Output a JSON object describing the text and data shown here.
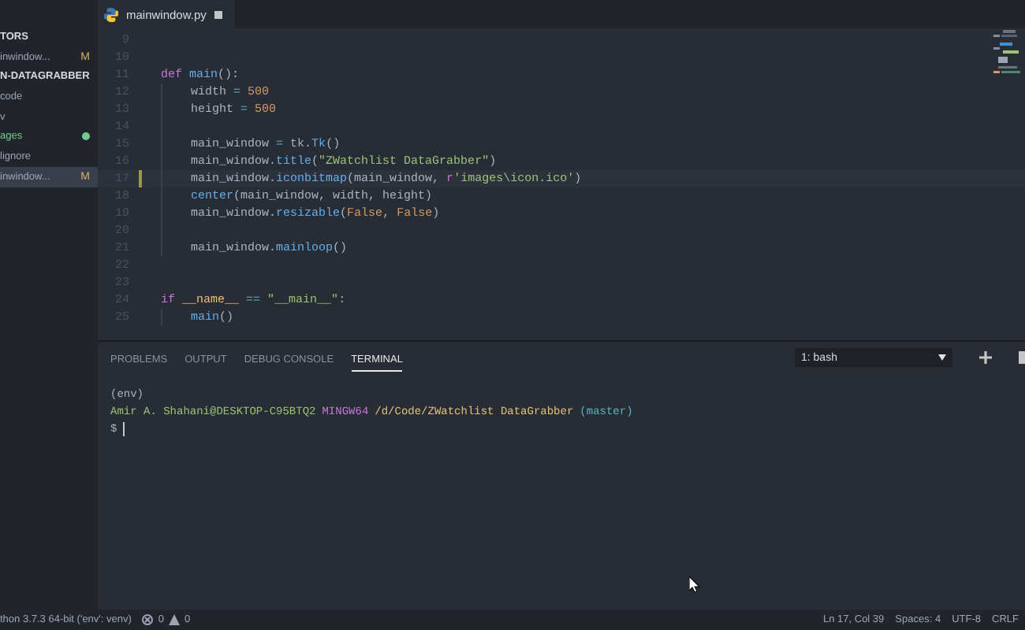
{
  "tab": {
    "title": "mainwindow.py",
    "modified": true
  },
  "sidebar": {
    "items": [
      {
        "label": "TORS",
        "kind": "header",
        "selected": false
      },
      {
        "label": "inwindow...",
        "badge": "M",
        "kind": "file",
        "selected": false
      },
      {
        "label": "N-DATAGRABBER",
        "kind": "header",
        "selected": false
      },
      {
        "label": "code",
        "kind": "folder",
        "selected": false
      },
      {
        "label": "v",
        "kind": "folder",
        "selected": false
      },
      {
        "label": "ages",
        "kind": "untracked",
        "selected": false
      },
      {
        "label": "lignore",
        "kind": "file",
        "selected": false
      },
      {
        "label": "inwindow...",
        "badge": "M",
        "kind": "file",
        "selected": true
      }
    ]
  },
  "editor": {
    "lines": [
      {
        "number": "9",
        "current": false
      },
      {
        "number": "10",
        "current": false
      },
      {
        "number": "11",
        "tokens": [
          {
            "text": "def ",
            "kind": "keyword"
          },
          {
            "text": "main",
            "kind": "func"
          },
          {
            "text": "():",
            "kind": "plain"
          }
        ],
        "current": false,
        "children": [
          {
            "number": "12",
            "tokens": [
              {
                "text": "width ",
                "kind": "plain"
              },
              {
                "text": "= ",
                "kind": "op"
              },
              {
                "text": "500",
                "kind": "number"
              }
            ],
            "current": false
          },
          {
            "number": "13",
            "tokens": [
              {
                "text": "height ",
                "kind": "plain"
              },
              {
                "text": "= ",
                "kind": "op"
              },
              {
                "text": "500",
                "kind": "number"
              }
            ],
            "current": false
          },
          {
            "number": "14",
            "current": false
          },
          {
            "number": "15",
            "tokens": [
              {
                "text": "main_window ",
                "kind": "plain"
              },
              {
                "text": "= ",
                "kind": "op"
              },
              {
                "text": "tk.",
                "kind": "plain"
              },
              {
                "text": "Tk",
                "kind": "func"
              },
              {
                "text": "()",
                "kind": "plain"
              }
            ],
            "current": false
          },
          {
            "number": "16",
            "tokens": [
              {
                "text": "main_window.",
                "kind": "plain"
              },
              {
                "text": "title",
                "kind": "func"
              },
              {
                "text": "(",
                "kind": "plain"
              },
              {
                "text": "\"ZWatchlist DataGrabber\"",
                "kind": "string"
              },
              {
                "text": ")",
                "kind": "plain"
              }
            ],
            "current": false
          },
          {
            "number": "17",
            "tokens": [
              {
                "text": "main_window.",
                "kind": "plain"
              },
              {
                "text": "iconbitmap",
                "kind": "func"
              },
              {
                "text": "(main_window, ",
                "kind": "plain"
              },
              {
                "text": "r",
                "kind": "keyword"
              },
              {
                "text": "'images\\icon.ico'",
                "kind": "string"
              },
              {
                "text": ")",
                "kind": "plain"
              }
            ],
            "current": true
          },
          {
            "number": "18",
            "tokens": [
              {
                "text": "center",
                "kind": "func"
              },
              {
                "text": "(main_window, width, height)",
                "kind": "plain"
              }
            ],
            "current": false
          },
          {
            "number": "19",
            "tokens": [
              {
                "text": "main_window.",
                "kind": "plain"
              },
              {
                "text": "resizable",
                "kind": "func"
              },
              {
                "text": "(",
                "kind": "plain"
              },
              {
                "text": "False",
                "kind": "number"
              },
              {
                "text": ", ",
                "kind": "plain"
              },
              {
                "text": "False",
                "kind": "number"
              },
              {
                "text": ")",
                "kind": "plain"
              }
            ],
            "current": false
          },
          {
            "number": "20",
            "current": false
          },
          {
            "number": "21",
            "tokens": [
              {
                "text": "main_window.",
                "kind": "plain"
              },
              {
                "text": "mainloop",
                "kind": "func"
              },
              {
                "text": "()",
                "kind": "plain"
              }
            ],
            "current": false
          }
        ]
      },
      {
        "number": "22",
        "current": false
      },
      {
        "number": "23",
        "current": false
      },
      {
        "number": "24",
        "tokens": [
          {
            "text": "if ",
            "kind": "keyword"
          },
          {
            "text": "__name__ ",
            "kind": "param"
          },
          {
            "text": "== ",
            "kind": "op"
          },
          {
            "text": "\"__main__\"",
            "kind": "string"
          },
          {
            "text": ":",
            "kind": "plain"
          }
        ],
        "current": false,
        "children": [
          {
            "number": "25",
            "tokens": [
              {
                "text": "main",
                "kind": "func"
              },
              {
                "text": "()",
                "kind": "plain"
              }
            ],
            "current": false
          }
        ]
      }
    ]
  },
  "panel": {
    "tabs": [
      {
        "label": "PROBLEMS",
        "selected": false
      },
      {
        "label": "OUTPUT",
        "selected": false
      },
      {
        "label": "DEBUG CONSOLE",
        "selected": false
      },
      {
        "label": "TERMINAL",
        "selected": true
      }
    ],
    "terminal_select": "1: bash",
    "terminal_lines": [
      [
        {
          "text": "(env)",
          "kind": "plain"
        }
      ],
      [
        {
          "text": "Amir A. Shahani@DESKTOP-C95BTQ2",
          "kind": "user"
        },
        {
          "text": "MINGW64",
          "kind": "host"
        },
        {
          "text": "/d/Code/ZWatchlist DataGrabber",
          "kind": "path"
        },
        {
          "text": "(master)",
          "kind": "branch"
        }
      ],
      [
        {
          "text": "$",
          "kind": "plain"
        }
      ]
    ]
  },
  "status_bar": {
    "interpreter": "thon 3.7.3 64-bit ('env': venv)",
    "errors": "0",
    "warnings": "0",
    "position": "Ln 17, Col 39",
    "spaces": "Spaces: 4",
    "encoding": "UTF-8",
    "eol": "CRLF"
  }
}
